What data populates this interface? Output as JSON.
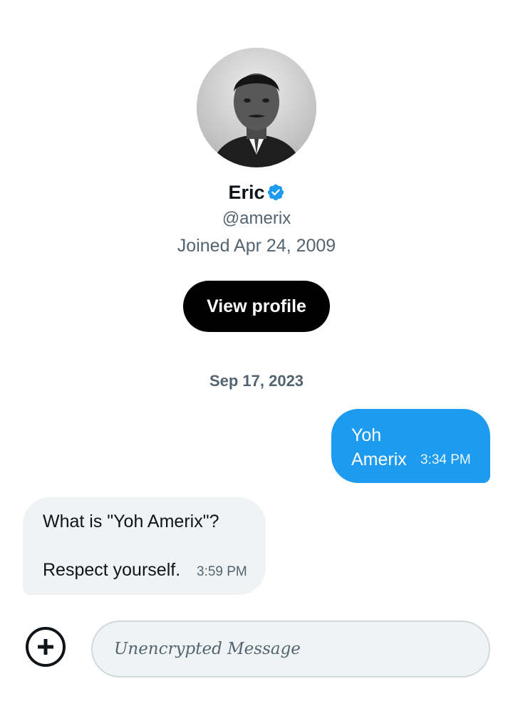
{
  "profile": {
    "name": "Eric",
    "handle": "@amerix",
    "joined": "Joined Apr 24, 2009",
    "view_profile_label": "View profile",
    "avatar_icon": "portrait-avatar",
    "verified_icon": "verified-badge-icon",
    "verified_color": "#1d9bf0"
  },
  "conversation": {
    "date_divider": "Sep 17, 2023",
    "messages": [
      {
        "direction": "sent",
        "text": "Yoh Amerix",
        "time": "3:34 PM",
        "bubble_color": "#1d9bf0"
      },
      {
        "direction": "received",
        "lines": [
          "What is \"Yoh Amerix\"?",
          "Respect yourself."
        ],
        "time": "3:59 PM",
        "bubble_color": "#eff3f4"
      }
    ]
  },
  "composer": {
    "placeholder": "Unencrypted Message",
    "add_icon": "plus-circle-icon"
  }
}
